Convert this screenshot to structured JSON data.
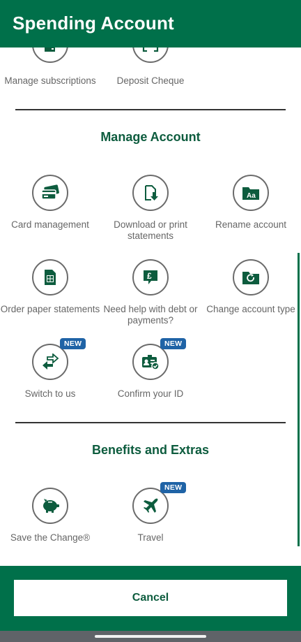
{
  "header": {
    "title": "Spending Account"
  },
  "top_row": [
    {
      "label": "Manage subscriptions",
      "icon": "subscriptions-icon"
    },
    {
      "label": "Deposit Cheque",
      "icon": "scan-cheque-icon"
    }
  ],
  "manage_account": {
    "title": "Manage Account",
    "items": [
      {
        "label": "Card management",
        "icon": "card-icon",
        "badge": ""
      },
      {
        "label": "Download or print statements",
        "icon": "download-document-icon",
        "badge": ""
      },
      {
        "label": "Rename account",
        "icon": "rename-folder-icon",
        "badge": ""
      },
      {
        "label": "Order paper statements",
        "icon": "paper-statement-icon",
        "badge": ""
      },
      {
        "label": "Need help with debt or payments?",
        "icon": "pound-chat-icon",
        "badge": ""
      },
      {
        "label": "Change account type",
        "icon": "change-folder-icon",
        "badge": ""
      },
      {
        "label": "Switch to us",
        "icon": "switch-arrows-icon",
        "badge": "NEW"
      },
      {
        "label": "Confirm your ID",
        "icon": "id-card-check-icon",
        "badge": "NEW"
      }
    ]
  },
  "benefits": {
    "title": "Benefits and Extras",
    "items": [
      {
        "label": "Save the Change®",
        "icon": "piggy-bank-icon",
        "badge": ""
      },
      {
        "label": "Travel",
        "icon": "airplane-icon",
        "badge": "NEW"
      }
    ]
  },
  "footer": {
    "cancel_label": "Cancel"
  },
  "colors": {
    "brand_green": "#00704a",
    "heading_green": "#0d5c3e",
    "badge_blue": "#1f63a6"
  }
}
